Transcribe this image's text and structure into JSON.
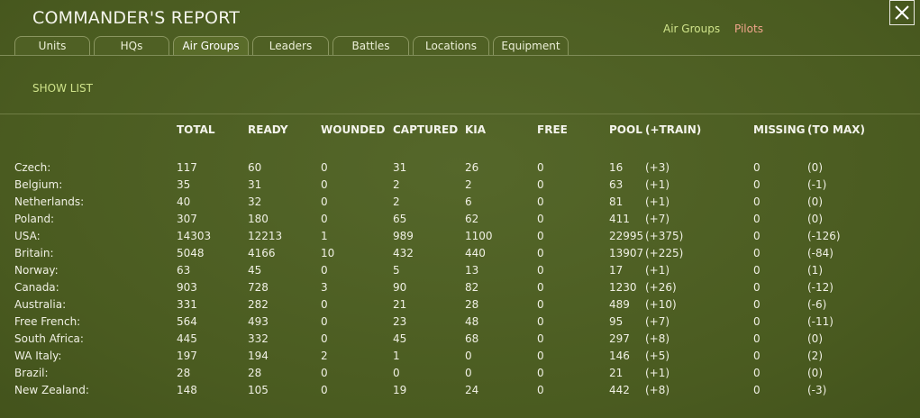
{
  "window": {
    "title": "COMMANDER'S REPORT"
  },
  "top_links": {
    "air_groups": "Air Groups",
    "pilots": "Pilots"
  },
  "tabs": [
    {
      "label": "Units",
      "active": false
    },
    {
      "label": "HQs",
      "active": false
    },
    {
      "label": "Air Groups",
      "active": true
    },
    {
      "label": "Leaders",
      "active": false
    },
    {
      "label": "Battles",
      "active": false
    },
    {
      "label": "Locations",
      "active": false
    },
    {
      "label": "Equipment",
      "active": false
    }
  ],
  "show_list": "SHOW LIST",
  "table": {
    "headers": {
      "total": "TOTAL",
      "ready": "READY",
      "wounded": "WOUNDED",
      "captured": "CAPTURED",
      "kia": "KIA",
      "free": "FREE",
      "pool": "POOL",
      "train": "(+TRAIN)",
      "missing": "MISSING",
      "to_max": "(TO MAX)"
    },
    "rows": [
      {
        "name": "Czech:",
        "total": "117",
        "ready": "60",
        "wounded": "0",
        "captured": "31",
        "kia": "26",
        "free": "0",
        "pool": "16",
        "train": "(+3)",
        "missing": "0",
        "to_max": "(0)"
      },
      {
        "name": "Belgium:",
        "total": "35",
        "ready": "31",
        "wounded": "0",
        "captured": "2",
        "kia": "2",
        "free": "0",
        "pool": "63",
        "train": "(+1)",
        "missing": "0",
        "to_max": "(-1)"
      },
      {
        "name": "Netherlands:",
        "total": "40",
        "ready": "32",
        "wounded": "0",
        "captured": "2",
        "kia": "6",
        "free": "0",
        "pool": "81",
        "train": "(+1)",
        "missing": "0",
        "to_max": "(0)"
      },
      {
        "name": "Poland:",
        "total": "307",
        "ready": "180",
        "wounded": "0",
        "captured": "65",
        "kia": "62",
        "free": "0",
        "pool": "411",
        "train": "(+7)",
        "missing": "0",
        "to_max": "(0)"
      },
      {
        "name": "USA:",
        "total": "14303",
        "ready": "12213",
        "wounded": "1",
        "captured": "989",
        "kia": "1100",
        "free": "0",
        "pool": "22995",
        "train": "(+375)",
        "missing": "0",
        "to_max": "(-126)"
      },
      {
        "name": "Britain:",
        "total": "5048",
        "ready": "4166",
        "wounded": "10",
        "captured": "432",
        "kia": "440",
        "free": "0",
        "pool": "13907",
        "train": "(+225)",
        "missing": "0",
        "to_max": "(-84)"
      },
      {
        "name": "Norway:",
        "total": "63",
        "ready": "45",
        "wounded": "0",
        "captured": "5",
        "kia": "13",
        "free": "0",
        "pool": "17",
        "train": "(+1)",
        "missing": "0",
        "to_max": "(1)"
      },
      {
        "name": "Canada:",
        "total": "903",
        "ready": "728",
        "wounded": "3",
        "captured": "90",
        "kia": "82",
        "free": "0",
        "pool": "1230",
        "train": "(+26)",
        "missing": "0",
        "to_max": "(-12)"
      },
      {
        "name": "Australia:",
        "total": "331",
        "ready": "282",
        "wounded": "0",
        "captured": "21",
        "kia": "28",
        "free": "0",
        "pool": "489",
        "train": "(+10)",
        "missing": "0",
        "to_max": "(-6)"
      },
      {
        "name": "Free French:",
        "total": "564",
        "ready": "493",
        "wounded": "0",
        "captured": "23",
        "kia": "48",
        "free": "0",
        "pool": "95",
        "train": "(+7)",
        "missing": "0",
        "to_max": "(-11)"
      },
      {
        "name": "South Africa:",
        "total": "445",
        "ready": "332",
        "wounded": "0",
        "captured": "45",
        "kia": "68",
        "free": "0",
        "pool": "297",
        "train": "(+8)",
        "missing": "0",
        "to_max": "(0)"
      },
      {
        "name": "WA Italy:",
        "total": "197",
        "ready": "194",
        "wounded": "2",
        "captured": "1",
        "kia": "0",
        "free": "0",
        "pool": "146",
        "train": "(+5)",
        "missing": "0",
        "to_max": "(2)"
      },
      {
        "name": "Brazil:",
        "total": "28",
        "ready": "28",
        "wounded": "0",
        "captured": "0",
        "kia": "0",
        "free": "0",
        "pool": "21",
        "train": "(+1)",
        "missing": "0",
        "to_max": "(0)"
      },
      {
        "name": "New Zealand:",
        "total": "148",
        "ready": "105",
        "wounded": "0",
        "captured": "19",
        "kia": "24",
        "free": "0",
        "pool": "442",
        "train": "(+8)",
        "missing": "0",
        "to_max": "(-3)"
      }
    ]
  },
  "colors": {
    "link_green": "#cfe38a",
    "link_salmon": "#f0a58c",
    "background": "#4d5e22"
  }
}
